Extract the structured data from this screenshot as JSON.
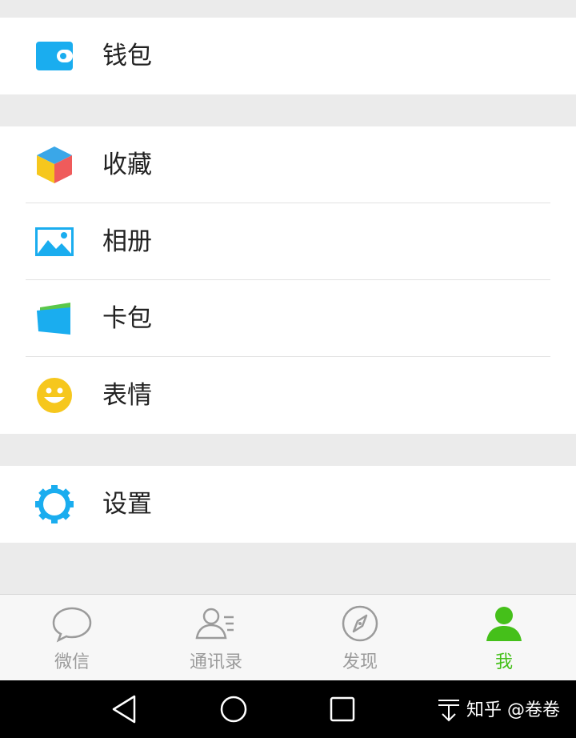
{
  "menu": {
    "wallet": {
      "label": "钱包",
      "icon": "wallet-icon",
      "color": "#1AADEF"
    },
    "favorites": {
      "label": "收藏",
      "icon": "cube-icon"
    },
    "album": {
      "label": "相册",
      "icon": "picture-icon",
      "color": "#1AADEF"
    },
    "cards": {
      "label": "卡包",
      "icon": "card-pack-icon"
    },
    "stickers": {
      "label": "表情",
      "icon": "smiley-icon",
      "color": "#F6C71D"
    },
    "settings": {
      "label": "设置",
      "icon": "gear-icon",
      "color": "#1AADEF"
    }
  },
  "tabbar": {
    "tabs": [
      {
        "label": "微信",
        "icon": "chat-bubble-icon",
        "active": false
      },
      {
        "label": "通讯录",
        "icon": "contacts-icon",
        "active": false
      },
      {
        "label": "发现",
        "icon": "compass-icon",
        "active": false
      },
      {
        "label": "我",
        "icon": "person-icon",
        "active": true
      }
    ],
    "active_color": "#45C01A",
    "inactive_color": "#9B9B9B"
  },
  "navbar": {
    "buttons": [
      "back-icon",
      "home-icon",
      "recents-icon"
    ],
    "watermark": "知乎 @卷卷"
  }
}
